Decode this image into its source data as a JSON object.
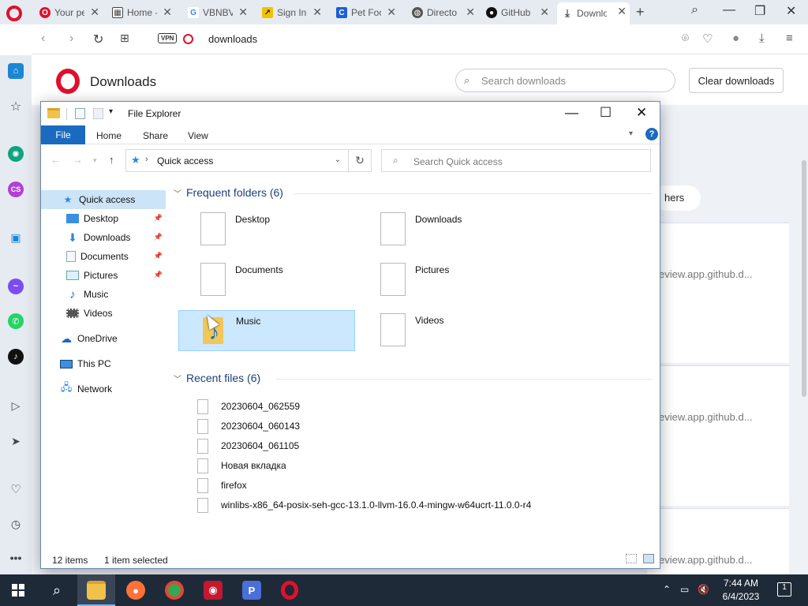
{
  "browser": {
    "tabs": [
      {
        "label": "Your pe",
        "icon": "opera-icon",
        "icon_color": "#e0102d"
      },
      {
        "label": "Home -",
        "icon": "calendar-icon",
        "icon_color": "#444444"
      },
      {
        "label": "VBNBV",
        "icon": "google-icon",
        "icon_color": "#4285f4"
      },
      {
        "label": "Sign In",
        "icon": "sign-in-icon",
        "icon_color": "#f2c200"
      },
      {
        "label": "Pet Foo",
        "icon": "c-icon",
        "icon_color": "#1b5fd6"
      },
      {
        "label": "Directo",
        "icon": "globe-icon",
        "icon_color": "#555555"
      },
      {
        "label": "GitHub",
        "icon": "github-icon",
        "icon_color": "#111111"
      },
      {
        "label": "Downlo",
        "icon": "download-icon",
        "icon_color": "#555555"
      }
    ],
    "vpn_label": "VPN",
    "address": "downloads"
  },
  "downloads_page": {
    "title": "Downloads",
    "search_placeholder": "Search downloads",
    "clear_label": "Clear downloads",
    "others_label": "hers",
    "items": [
      {
        "source": "eview.app.github.d..."
      },
      {
        "source": "eview.app.github.d..."
      },
      {
        "source": "eview.app.github.d..."
      }
    ]
  },
  "explorer": {
    "title": "File Explorer",
    "ribbon": {
      "file": "File",
      "home": "Home",
      "share": "Share",
      "view": "View"
    },
    "address_path": "Quick access",
    "search_placeholder": "Search Quick access",
    "nav": [
      {
        "label": "Quick access",
        "icon": "star-icon",
        "pinned": false,
        "selected": true
      },
      {
        "label": "Desktop",
        "icon": "desktop-icon",
        "pinned": true
      },
      {
        "label": "Downloads",
        "icon": "download-arrow-icon",
        "pinned": true
      },
      {
        "label": "Documents",
        "icon": "document-icon",
        "pinned": true
      },
      {
        "label": "Pictures",
        "icon": "pictures-icon",
        "pinned": true
      },
      {
        "label": "Music",
        "icon": "music-icon",
        "pinned": false
      },
      {
        "label": "Videos",
        "icon": "videos-icon",
        "pinned": false
      },
      {
        "label": "OneDrive",
        "icon": "cloud-icon",
        "pinned": false
      },
      {
        "label": "This PC",
        "icon": "computer-icon",
        "pinned": false
      },
      {
        "label": "Network",
        "icon": "network-icon",
        "pinned": false
      }
    ],
    "frequent_header": "Frequent folders (6)",
    "frequent": [
      {
        "name": "Desktop"
      },
      {
        "name": "Downloads"
      },
      {
        "name": "Documents"
      },
      {
        "name": "Pictures"
      },
      {
        "name": "Music",
        "selected": true
      },
      {
        "name": "Videos"
      }
    ],
    "recent_header": "Recent files (6)",
    "recent": [
      "20230604_062559",
      "20230604_060143",
      "20230604_061105",
      "Новая вкладка",
      "firefox",
      "winlibs-x86_64-posix-seh-gcc-13.1.0-llvm-16.0.4-mingw-w64ucrt-11.0.0-r4"
    ],
    "status_items": "12 items",
    "status_selected": "1 item selected"
  },
  "taskbar": {
    "time": "7:44 AM",
    "date": "6/4/2023",
    "notification_count": "1",
    "pinned": [
      "search-icon",
      "file-explorer-icon",
      "firefox-icon",
      "chrome-icon",
      "screen-recorder-icon",
      "p-app-icon",
      "opera-icon"
    ]
  },
  "colors": {
    "opera_red": "#e0102d",
    "explorer_blue": "#1a6ac0",
    "selection": "#cce8ff",
    "taskbar": "#1f2a38"
  }
}
